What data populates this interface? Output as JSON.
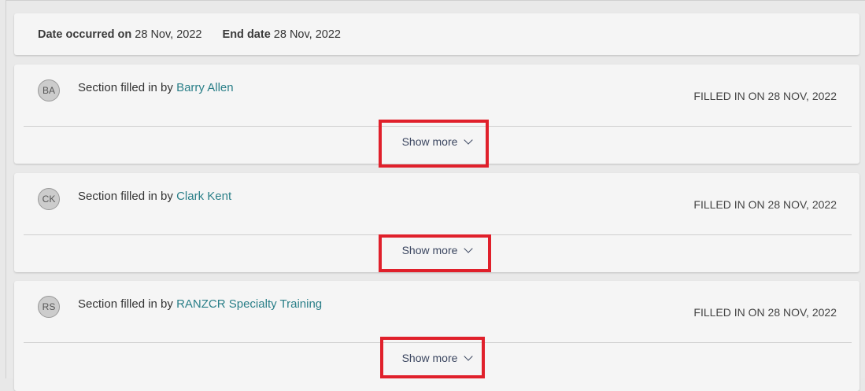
{
  "header": {
    "date_occurred_label": "Date occurred on",
    "date_occurred_value": "28 Nov, 2022",
    "end_date_label": "End date",
    "end_date_value": "28 Nov, 2022"
  },
  "sections": [
    {
      "initials": "BA",
      "filled_by_prefix": "Section filled in by",
      "filled_by_name": "Barry Allen",
      "filled_on_prefix": "FILLED IN ON",
      "filled_on_date": "28 NOV, 2022",
      "show_more_label": "Show more"
    },
    {
      "initials": "CK",
      "filled_by_prefix": "Section filled in by",
      "filled_by_name": "Clark Kent",
      "filled_on_prefix": "FILLED IN ON",
      "filled_on_date": "28 NOV, 2022",
      "show_more_label": "Show more"
    },
    {
      "initials": "RS",
      "filled_by_prefix": "Section filled in by",
      "filled_by_name": "RANZCR Specialty Training",
      "filled_on_prefix": "FILLED IN ON",
      "filled_on_date": "28 NOV, 2022",
      "show_more_label": "Show more"
    }
  ],
  "colors": {
    "link_name": "#2a7f88",
    "highlight": "#e0202b",
    "show_more_text": "#3b4660"
  },
  "icons": {
    "show_more": "chevron-down-icon"
  }
}
